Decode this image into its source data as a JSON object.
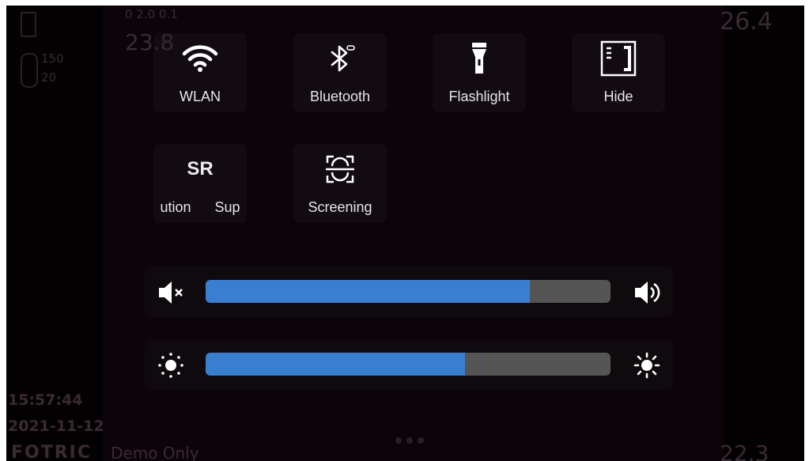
{
  "hud": {
    "reading_top_left": "23.8",
    "reading_top_right": "26.4",
    "reading_bottom_right": "22.3",
    "scale_high": "150",
    "scale_low": "20",
    "time": "15:57:44",
    "date": "2021-11-12",
    "brand": "FOTRIC",
    "brand_sub": "Demo Only",
    "top_label": "0 2.0 0.1"
  },
  "quick_settings": {
    "tiles": [
      {
        "label": "WLAN",
        "icon": "wifi-icon"
      },
      {
        "label": "Bluetooth",
        "icon": "bluetooth-icon"
      },
      {
        "label": "Flashlight",
        "icon": "flashlight-icon"
      },
      {
        "label": "Hide",
        "icon": "hide-panel-icon"
      },
      {
        "label": "ution      Sup",
        "icon_text": "SR"
      },
      {
        "label": "Screening",
        "icon": "face-scan-icon"
      }
    ]
  },
  "sliders": {
    "volume": {
      "level": 0.8,
      "min_icon": "volume-mute-icon",
      "max_icon": "volume-up-icon"
    },
    "brightness": {
      "level": 0.64,
      "min_icon": "brightness-low-icon",
      "max_icon": "brightness-high-icon"
    }
  },
  "colors": {
    "fill": "#3a7ecf",
    "track": "#555555",
    "background": "#040103"
  }
}
